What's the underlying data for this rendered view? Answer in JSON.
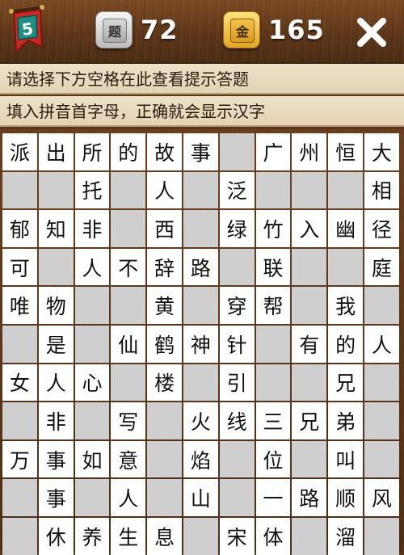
{
  "header": {
    "level": "5",
    "questions_count": "72",
    "gold_count": "165",
    "question_icon_char": "题",
    "gold_icon_char": "金",
    "icons": {
      "level": "level-flag-icon",
      "question": "question-tile-icon",
      "gold": "gold-coin-icon",
      "close": "close-icon"
    }
  },
  "hints": {
    "line1": "请选择下方空格在此查看提示答题",
    "line2": "填入拼音首字母，正确就会显示汉字"
  },
  "grid": {
    "rows": [
      [
        "派",
        "出",
        "所",
        "的",
        "故",
        "事",
        "",
        "广",
        "州",
        "恒",
        "大"
      ],
      [
        "",
        "",
        "托",
        "",
        "人",
        "",
        "泛",
        "",
        "",
        "",
        "相"
      ],
      [
        "郁",
        "知",
        "非",
        "",
        "西",
        "",
        "绿",
        "竹",
        "入",
        "幽",
        "径"
      ],
      [
        "可",
        "",
        "人",
        "不",
        "辞",
        "路",
        "",
        "联",
        "",
        "",
        "庭"
      ],
      [
        "唯",
        "物",
        "",
        "",
        "黄",
        "",
        "穿",
        "帮",
        "",
        "我",
        ""
      ],
      [
        "",
        "是",
        "",
        "仙",
        "鹤",
        "神",
        "针",
        "",
        "有",
        "的",
        "人"
      ],
      [
        "女",
        "人",
        "心",
        "",
        "楼",
        "",
        "引",
        "",
        "",
        "兄",
        ""
      ],
      [
        "",
        "非",
        "",
        "写",
        "",
        "火",
        "线",
        "三",
        "兄",
        "弟",
        ""
      ],
      [
        "万",
        "事",
        "如",
        "意",
        "",
        "焰",
        "",
        "位",
        "",
        "叫",
        ""
      ],
      [
        "",
        "事",
        "",
        "人",
        "",
        "山",
        "",
        "一",
        "路",
        "顺",
        "风"
      ],
      [
        "",
        "休",
        "养",
        "生",
        "息",
        "",
        "宋",
        "体",
        "",
        "溜",
        ""
      ]
    ],
    "filled_mask": [
      [
        1,
        1,
        1,
        1,
        1,
        1,
        0,
        1,
        1,
        1,
        1
      ],
      [
        0,
        0,
        1,
        0,
        1,
        0,
        1,
        0,
        0,
        0,
        1
      ],
      [
        1,
        1,
        1,
        0,
        1,
        0,
        1,
        1,
        1,
        1,
        1
      ],
      [
        1,
        0,
        1,
        1,
        1,
        1,
        0,
        1,
        0,
        0,
        1
      ],
      [
        1,
        1,
        0,
        0,
        1,
        0,
        1,
        1,
        0,
        1,
        0
      ],
      [
        0,
        1,
        0,
        1,
        1,
        1,
        1,
        0,
        1,
        1,
        1
      ],
      [
        1,
        1,
        1,
        0,
        1,
        0,
        1,
        0,
        0,
        1,
        0
      ],
      [
        0,
        1,
        0,
        1,
        0,
        1,
        1,
        1,
        1,
        1,
        0
      ],
      [
        1,
        1,
        1,
        1,
        0,
        1,
        0,
        1,
        0,
        1,
        0
      ],
      [
        0,
        1,
        0,
        1,
        0,
        1,
        0,
        1,
        1,
        1,
        1
      ],
      [
        0,
        1,
        1,
        1,
        1,
        0,
        1,
        1,
        0,
        1,
        0
      ]
    ]
  },
  "colors": {
    "wood": "#5a3519",
    "hint_bg": "#e8dabe",
    "cell_filled": "#ffffff",
    "cell_empty": "#cfcfcf",
    "flag_red": "#c62a22",
    "flag_teal": "#1f8f86",
    "gold": "#f2b632"
  }
}
